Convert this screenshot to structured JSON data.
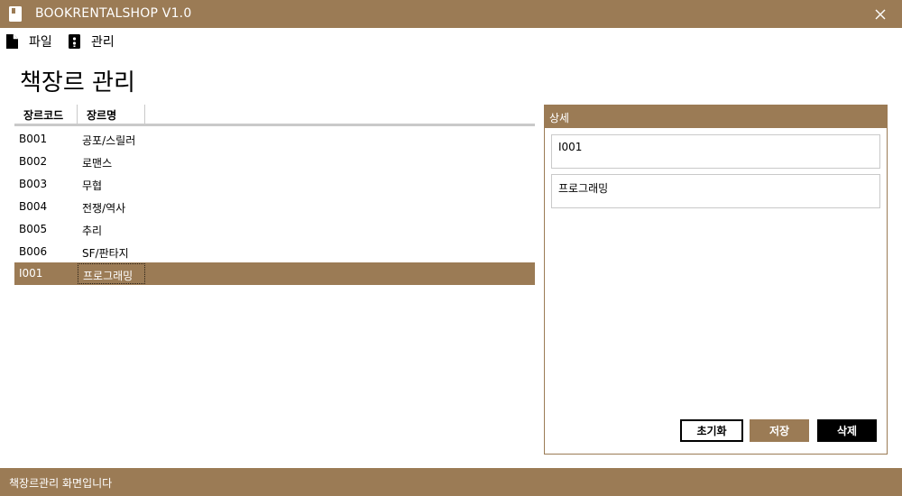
{
  "window": {
    "title": "BOOKRENTALSHOP V1.0",
    "icon": "book-icon",
    "close_icon": "close-icon"
  },
  "menu": {
    "items": [
      {
        "label": "파일",
        "icon": "file-icon"
      },
      {
        "label": "관리",
        "icon": "manage-icon"
      }
    ]
  },
  "page": {
    "title": "책장르 관리"
  },
  "grid": {
    "columns": [
      "장르코드",
      "장르명"
    ],
    "rows": [
      {
        "code": "B001",
        "name": "공포/스릴러"
      },
      {
        "code": "B002",
        "name": "로맨스"
      },
      {
        "code": "B003",
        "name": "무협"
      },
      {
        "code": "B004",
        "name": "전쟁/역사"
      },
      {
        "code": "B005",
        "name": "추리"
      },
      {
        "code": "B006",
        "name": "SF/판타지"
      },
      {
        "code": "I001",
        "name": "프로그래밍"
      }
    ],
    "selected_index": 6
  },
  "detail": {
    "header": "상세",
    "code_value": "I001",
    "name_value": "프로그래밍",
    "buttons": {
      "reset": "초기화",
      "save": "저장",
      "delete": "삭제"
    }
  },
  "status": {
    "text": "책장르관리 화면입니다"
  },
  "colors": {
    "accent": "#9b7b55",
    "dark": "#000000",
    "text_light": "#ffffff"
  }
}
